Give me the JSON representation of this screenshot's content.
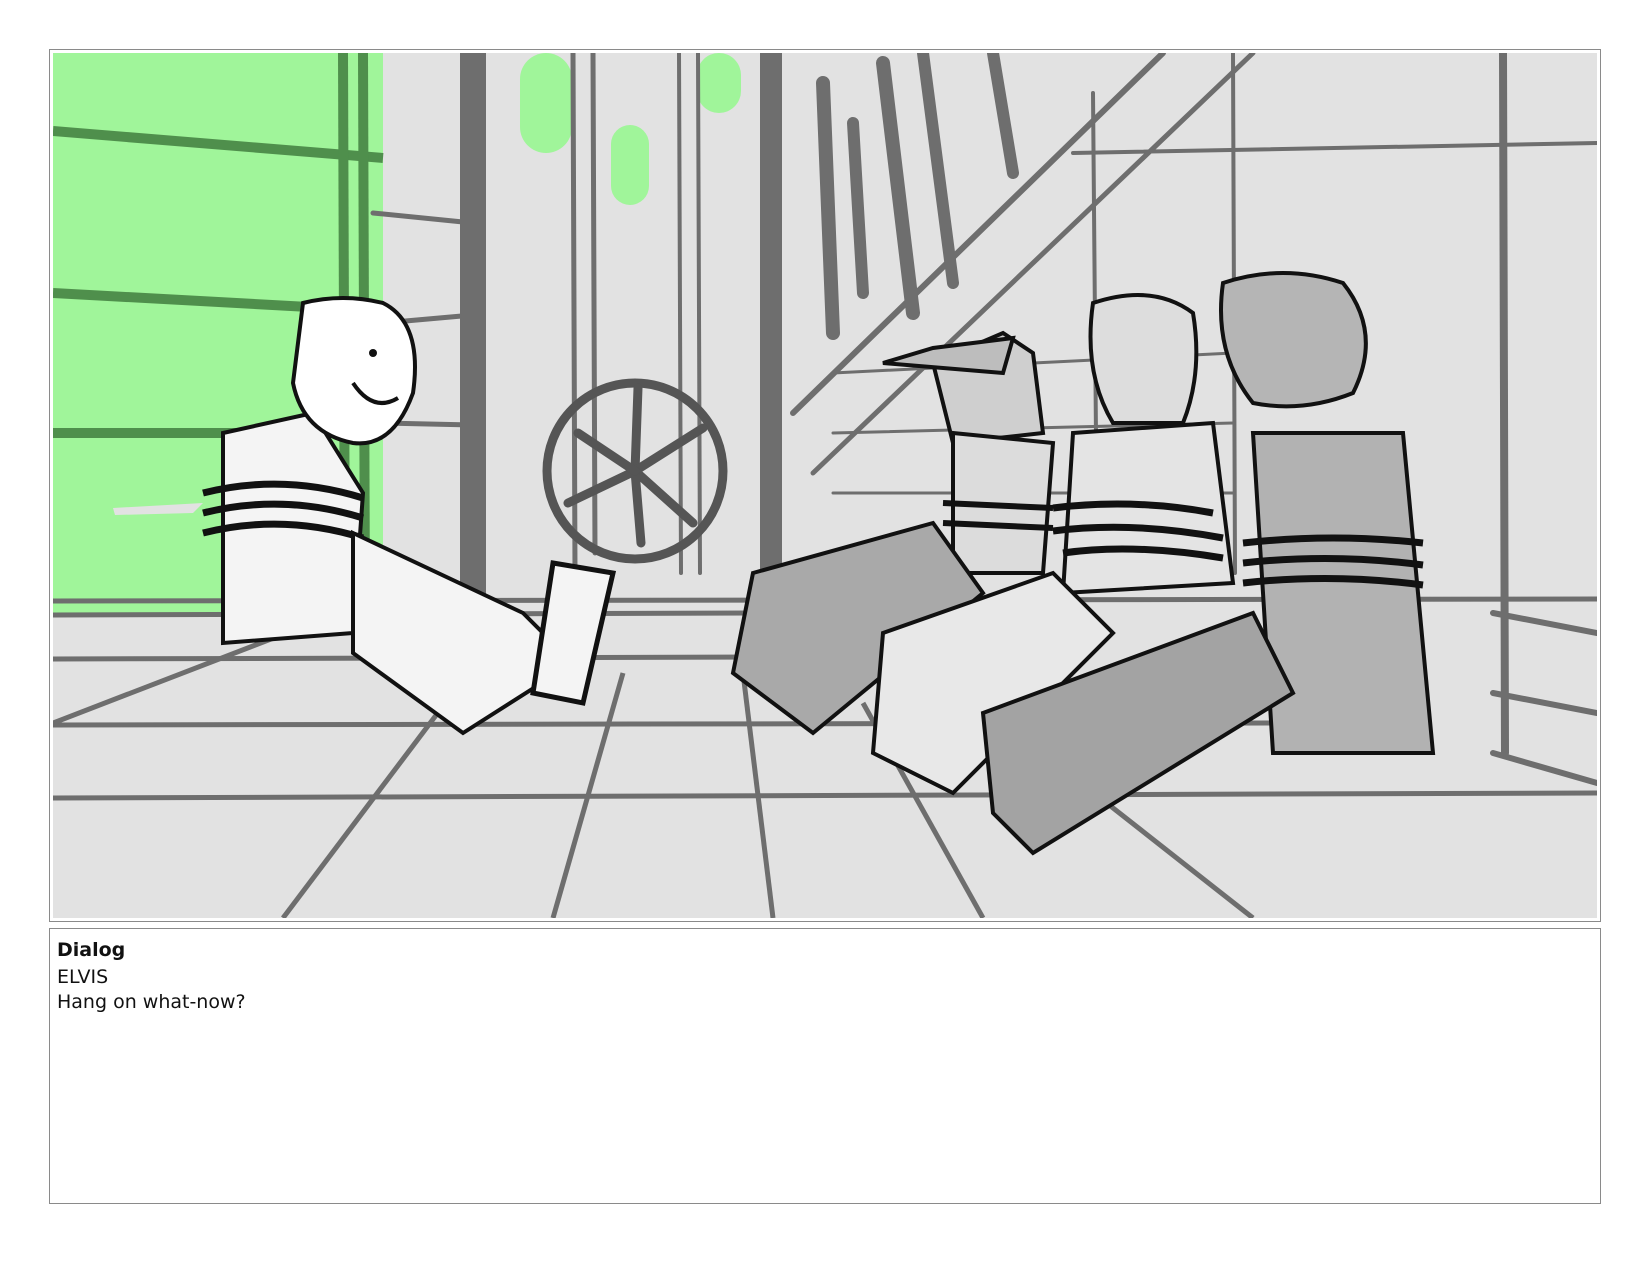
{
  "dialog": {
    "heading": "Dialog",
    "character": "ELVIS",
    "line": "Hang on what-now?"
  },
  "colors": {
    "accent_green": "#a0f59a",
    "background_grey": "#e2e2e2",
    "line_grey": "#6e6e6e",
    "ink": "#111111"
  }
}
